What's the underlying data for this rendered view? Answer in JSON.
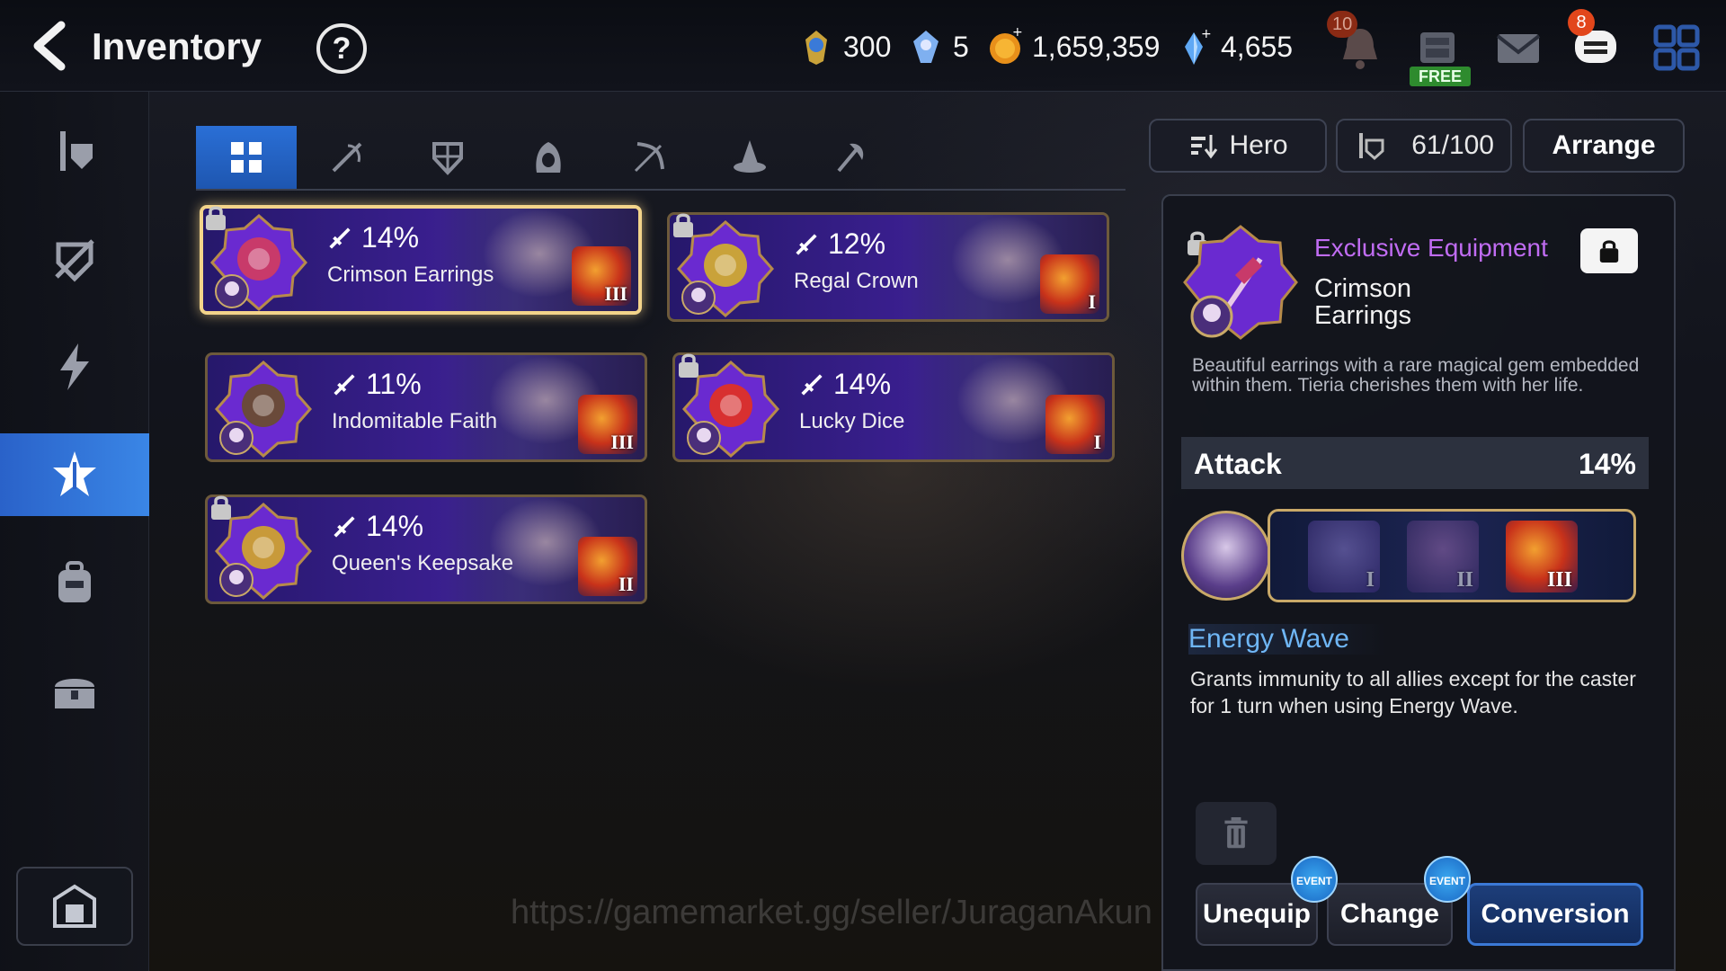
{
  "header": {
    "title": "Inventory",
    "help_label": "?",
    "currencies": [
      {
        "name": "stamina-icon",
        "value": "300"
      },
      {
        "name": "crystal-icon",
        "value": "5"
      },
      {
        "name": "gold-icon",
        "value": "1,659,359"
      },
      {
        "name": "skystone-icon",
        "value": "4,655"
      }
    ],
    "notification_badge": "10",
    "free_label": "FREE",
    "chat_badge": "8"
  },
  "sidebar": {
    "items": [
      {
        "icon": "hero-gear-icon",
        "active": false
      },
      {
        "icon": "weapon-shield-icon",
        "active": false
      },
      {
        "icon": "lightning-icon",
        "active": false
      },
      {
        "icon": "artifact-icon",
        "active": true
      },
      {
        "icon": "bag-icon",
        "active": false
      },
      {
        "icon": "chest-icon",
        "active": false
      }
    ],
    "bottom_icon": "storage-icon"
  },
  "tabs": [
    {
      "icon": "grid-icon",
      "active": true
    },
    {
      "icon": "sword-icon",
      "active": false
    },
    {
      "icon": "shield-icon",
      "active": false
    },
    {
      "icon": "hood-icon",
      "active": false
    },
    {
      "icon": "bow-icon",
      "active": false
    },
    {
      "icon": "mage-hat-icon",
      "active": false
    },
    {
      "icon": "scythe-icon",
      "active": false
    }
  ],
  "toolbar": {
    "sort_label": "Hero",
    "capacity": "61/100",
    "arrange_label": "Arrange"
  },
  "items": [
    {
      "stat": "14%",
      "name": "Crimson Earrings",
      "skill_rank": "III",
      "locked": true,
      "selected": true,
      "color": "#c83a6a"
    },
    {
      "stat": "12%",
      "name": "Regal Crown",
      "skill_rank": "I",
      "locked": true,
      "selected": false,
      "color": "#c9a23a"
    },
    {
      "stat": "11%",
      "name": "Indomitable Faith",
      "skill_rank": "III",
      "locked": false,
      "selected": false,
      "color": "#6a4a3a"
    },
    {
      "stat": "14%",
      "name": "Lucky Dice",
      "skill_rank": "I",
      "locked": true,
      "selected": false,
      "color": "#d83030"
    },
    {
      "stat": "14%",
      "name": "Queen's Keepsake",
      "skill_rank": "II",
      "locked": true,
      "selected": false,
      "color": "#c89a3a"
    }
  ],
  "detail": {
    "kind": "Exclusive Equipment",
    "name": "Crimson Earrings",
    "description": "Beautiful earrings with a rare magical gem embedded within them. Tieria cherishes them with her life.",
    "stat_label": "Attack",
    "stat_value": "14%",
    "skill_ranks": [
      "I",
      "II",
      "III"
    ],
    "skill_name": "Energy Wave",
    "skill_description": "Grants immunity to all allies except for the caster for 1 turn when using Energy Wave.",
    "buttons": {
      "unequip": "Unequip",
      "change": "Change",
      "conversion": "Conversion"
    },
    "event_label": "EVENT"
  },
  "watermark": "https://gamemarket.gg/seller/JuraganAkun"
}
